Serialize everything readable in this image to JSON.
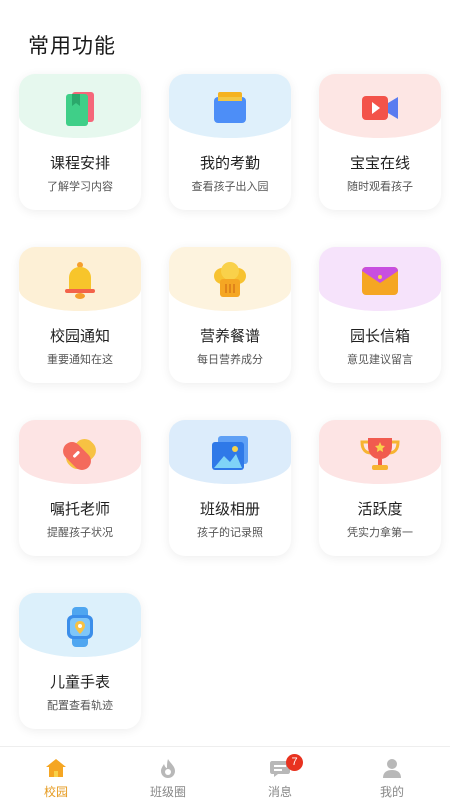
{
  "section": {
    "title": "常用功能"
  },
  "features": [
    {
      "title": "课程安排",
      "subtitle": "了解学习内容",
      "icon": "book-icon",
      "bg": "#e6f8ee"
    },
    {
      "title": "我的考勤",
      "subtitle": "查看孩子出入园",
      "icon": "folder-icon",
      "bg": "#dff0fb"
    },
    {
      "title": "宝宝在线",
      "subtitle": "随时观看孩子",
      "icon": "video-camera-icon",
      "bg": "#fde6e4"
    },
    {
      "title": "校园通知",
      "subtitle": "重要通知在这",
      "icon": "bell-icon",
      "bg": "#fdf0d6"
    },
    {
      "title": "营养餐谱",
      "subtitle": "每日营养成分",
      "icon": "chef-hat-icon",
      "bg": "#fdf3de"
    },
    {
      "title": "园长信箱",
      "subtitle": "意见建议留言",
      "icon": "envelope-icon",
      "bg": "#f6e3fb"
    },
    {
      "title": "嘱托老师",
      "subtitle": "提醒孩子状况",
      "icon": "bandage-icon",
      "bg": "#fde4e4"
    },
    {
      "title": "班级相册",
      "subtitle": "孩子的记录照",
      "icon": "photo-album-icon",
      "bg": "#dcecfb"
    },
    {
      "title": "活跃度",
      "subtitle": "凭实力拿第一",
      "icon": "trophy-icon",
      "bg": "#fde4e4"
    },
    {
      "title": "儿童手表",
      "subtitle": "配置查看轨迹",
      "icon": "smartwatch-icon",
      "bg": "#dcf0fb"
    }
  ],
  "tabbar": {
    "items": [
      {
        "label": "校园",
        "icon": "home-icon",
        "active": true
      },
      {
        "label": "班级圈",
        "icon": "flame-icon"
      },
      {
        "label": "消息",
        "icon": "message-icon",
        "badge": "7"
      },
      {
        "label": "我的",
        "icon": "user-icon"
      }
    ]
  },
  "colors": {
    "accent": "#e59a1f",
    "badge": "#e8321f"
  }
}
